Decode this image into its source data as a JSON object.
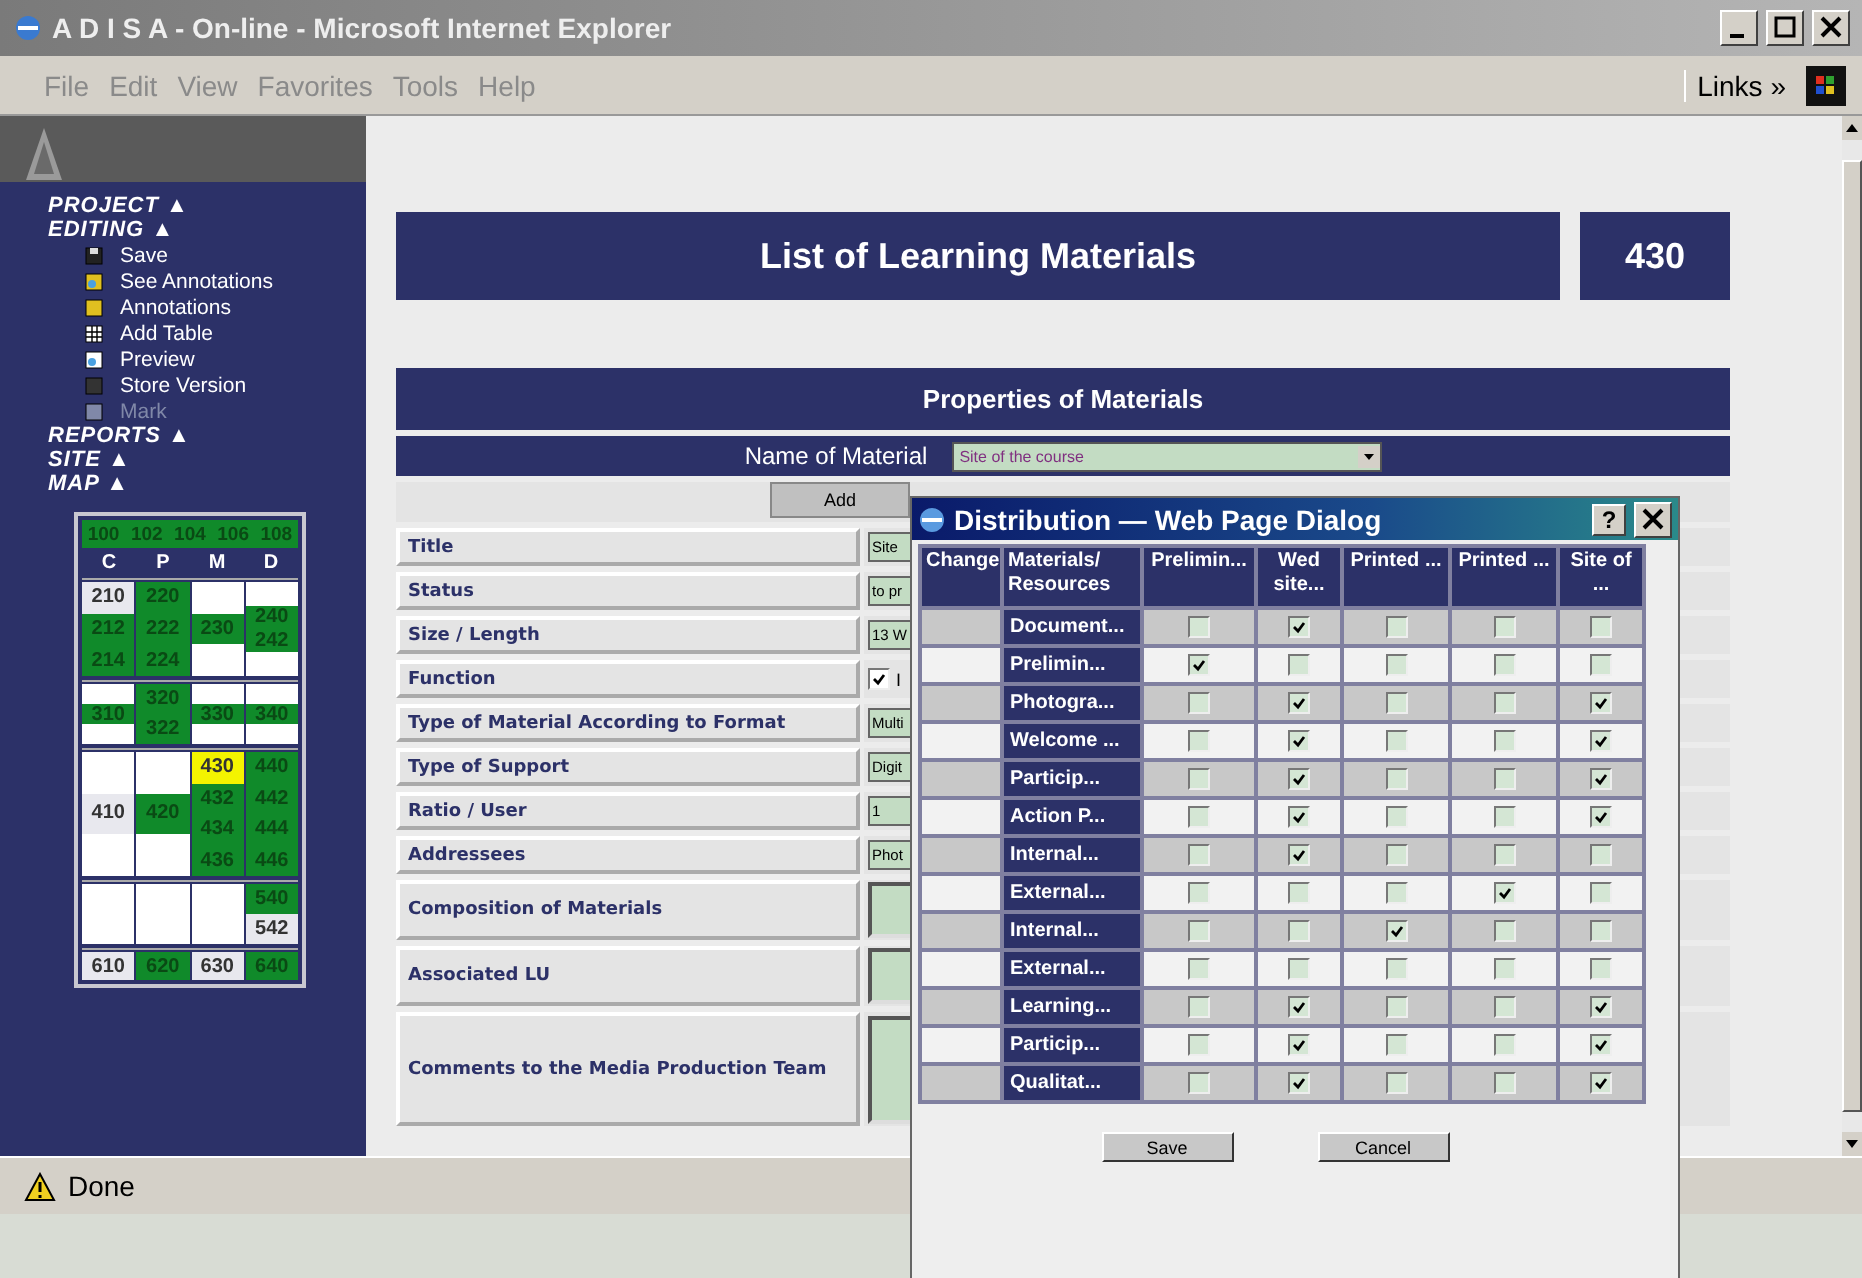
{
  "window": {
    "title": "A D I S A - On-line - Microsoft Internet Explorer"
  },
  "menu": [
    "File",
    "Edit",
    "View",
    "Favorites",
    "Tools",
    "Help"
  ],
  "links": {
    "label": "Links",
    "chevron": "»"
  },
  "sidebar": {
    "sections": [
      {
        "label": "PROJECT",
        "arrow": "▲"
      },
      {
        "label": "EDITING",
        "arrow": "▲",
        "items": [
          {
            "label": "Save",
            "kind": "save",
            "disabled": false
          },
          {
            "label": "See Annotations",
            "kind": "see",
            "disabled": false
          },
          {
            "label": "Annotations",
            "kind": "notes",
            "disabled": false
          },
          {
            "label": "Add Table",
            "kind": "table",
            "disabled": false
          },
          {
            "label": "Preview",
            "kind": "preview",
            "disabled": false
          },
          {
            "label": "Store Version",
            "kind": "store",
            "disabled": false
          },
          {
            "label": "Mark",
            "kind": "mark",
            "disabled": true
          }
        ]
      },
      {
        "label": "REPORTS",
        "arrow": "▲"
      },
      {
        "label": "SITE",
        "arrow": "▲"
      },
      {
        "label": "MAP",
        "arrow": "▲"
      }
    ]
  },
  "map": {
    "header": [
      "100",
      "102",
      "104",
      "106",
      "108"
    ],
    "letters": [
      "C",
      "P",
      "M",
      "D"
    ],
    "sections": [
      [
        [
          {
            "label": "210",
            "color": "#e8e8ee"
          },
          {
            "label": "212",
            "color": "#108a2a"
          },
          {
            "label": "214",
            "color": "#108a2a"
          }
        ],
        [
          {
            "label": "220",
            "color": "#108a2a"
          },
          {
            "label": "222",
            "color": "#108a2a"
          },
          {
            "label": "224",
            "color": "#108a2a"
          }
        ],
        [
          {
            "color": "#ffffff"
          },
          {
            "label": "230",
            "color": "#108a2a"
          },
          {
            "color": "#ffffff"
          }
        ],
        [
          {
            "color": "#ffffff"
          },
          {
            "label": "240",
            "color": "#108a2a"
          },
          {
            "label": "242",
            "color": "#108a2a"
          },
          {
            "color": "#ffffff"
          }
        ]
      ],
      [
        [
          {
            "color": "#ffffff"
          },
          {
            "label": "310",
            "color": "#108a2a"
          },
          {
            "color": "#ffffff"
          }
        ],
        [
          {
            "label": "320",
            "color": "#108a2a"
          },
          {
            "label": "322",
            "color": "#108a2a"
          }
        ],
        [
          {
            "color": "#ffffff"
          },
          {
            "label": "330",
            "color": "#108a2a"
          },
          {
            "color": "#ffffff"
          }
        ],
        [
          {
            "color": "#ffffff"
          },
          {
            "label": "340",
            "color": "#108a2a"
          },
          {
            "color": "#ffffff"
          }
        ]
      ],
      [
        [
          {
            "color": "#ffffff"
          },
          {
            "label": "410",
            "color": "#e8e8ee"
          },
          {
            "color": "#ffffff"
          }
        ],
        [
          {
            "color": "#ffffff"
          },
          {
            "label": "420",
            "color": "#108a2a"
          },
          {
            "color": "#ffffff"
          }
        ],
        [
          {
            "label": "430",
            "color": "#f4f400"
          },
          {
            "label": "432",
            "color": "#108a2a"
          },
          {
            "label": "434",
            "color": "#108a2a"
          },
          {
            "label": "436",
            "color": "#108a2a"
          }
        ],
        [
          {
            "label": "440",
            "color": "#108a2a"
          },
          {
            "label": "442",
            "color": "#108a2a"
          },
          {
            "label": "444",
            "color": "#108a2a"
          },
          {
            "label": "446",
            "color": "#108a2a"
          }
        ]
      ],
      [
        [
          {
            "color": "#ffffff"
          }
        ],
        [
          {
            "color": "#ffffff"
          }
        ],
        [
          {
            "color": "#ffffff"
          }
        ],
        [
          {
            "label": "540",
            "color": "#108a2a"
          },
          {
            "label": "542",
            "color": "#e8e8ee"
          }
        ]
      ],
      [
        [
          {
            "label": "610",
            "color": "#e8e8ee"
          }
        ],
        [
          {
            "label": "620",
            "color": "#108a2a"
          }
        ],
        [
          {
            "label": "630",
            "color": "#e8e8ee"
          }
        ],
        [
          {
            "label": "640",
            "color": "#108a2a"
          }
        ]
      ]
    ]
  },
  "page": {
    "title": "List of Learning Materials",
    "number": "430",
    "panel_title": "Properties of Materials",
    "name_label": "Name of Material",
    "name_value": "Site of the course",
    "add_button": "Add",
    "fields": [
      {
        "label": "Title",
        "kind": "text",
        "value": "Site"
      },
      {
        "label": "Status",
        "kind": "text",
        "value": "to pr"
      },
      {
        "label": "Size / Length",
        "kind": "text",
        "value": "13 W"
      },
      {
        "label": "Function",
        "kind": "check",
        "checked": true,
        "value": "I"
      },
      {
        "label": "Type of Material According to Format",
        "kind": "text",
        "value": "Multi"
      },
      {
        "label": "Type of Support",
        "kind": "text",
        "value": "Digit"
      },
      {
        "label": "Ratio / User",
        "kind": "text",
        "value": "1"
      },
      {
        "label": "Addressees",
        "kind": "text",
        "value": "Phot"
      },
      {
        "label": "Composition of Materials",
        "kind": "area"
      },
      {
        "label": "Associated LU",
        "kind": "area"
      },
      {
        "label": "Comments to the Media Production Team",
        "kind": "bigarea"
      }
    ]
  },
  "dialog": {
    "title": "Distribution — Web Page Dialog",
    "help": "?",
    "columns": [
      "Change",
      "Materials/ Resources",
      "Prelimin...",
      "Wed site...",
      "Printed ...",
      "Printed ...",
      "Site of ..."
    ],
    "rows": [
      {
        "name": "Document...",
        "checks": [
          false,
          true,
          false,
          false,
          false
        ]
      },
      {
        "name": "Prelimin...",
        "checks": [
          true,
          false,
          false,
          false,
          false
        ]
      },
      {
        "name": "Photogra...",
        "checks": [
          false,
          true,
          false,
          false,
          true
        ]
      },
      {
        "name": "Welcome ...",
        "checks": [
          false,
          true,
          false,
          false,
          true
        ]
      },
      {
        "name": "Particip...",
        "checks": [
          false,
          true,
          false,
          false,
          true
        ]
      },
      {
        "name": "Action P...",
        "checks": [
          false,
          true,
          false,
          false,
          true
        ]
      },
      {
        "name": "Internal...",
        "checks": [
          false,
          true,
          false,
          false,
          false
        ]
      },
      {
        "name": "External...",
        "checks": [
          false,
          false,
          false,
          true,
          false
        ]
      },
      {
        "name": "Internal...",
        "checks": [
          false,
          false,
          true,
          false,
          false
        ]
      },
      {
        "name": "External...",
        "checks": [
          false,
          false,
          false,
          false,
          false
        ]
      },
      {
        "name": "Learning...",
        "checks": [
          false,
          true,
          false,
          false,
          true
        ]
      },
      {
        "name": "Particip...",
        "checks": [
          false,
          true,
          false,
          false,
          true
        ]
      },
      {
        "name": "Qualitat...",
        "checks": [
          false,
          true,
          false,
          false,
          true
        ]
      }
    ],
    "buttons": [
      "Save",
      "Cancel"
    ]
  },
  "status": {
    "text": "Done"
  }
}
